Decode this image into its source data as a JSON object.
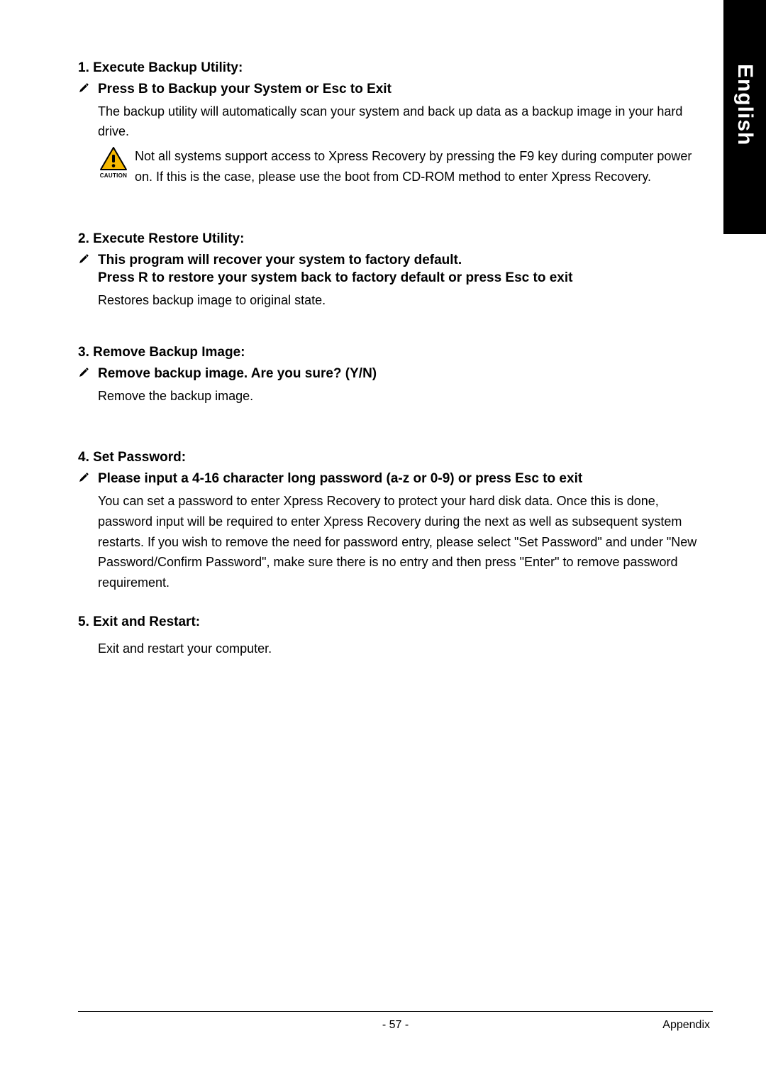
{
  "side_tab": "English",
  "sections": {
    "s1": {
      "head": "1. Execute Backup Utility:",
      "bullet": "Press B to Backup your System or Esc to Exit",
      "body": "The backup utility will automatically scan your system and back up data as a backup image in your hard drive.",
      "caution_label": "CAUTION",
      "caution_text": "Not all systems support access to Xpress Recovery by pressing the F9 key during computer power on. If this is the case, please use the boot from CD-ROM method to enter Xpress Recovery."
    },
    "s2": {
      "head": "2. Execute Restore Utility:",
      "bullet1": "This program will recover your system to factory default.",
      "bullet2": "Press R to restore your system back to factory default or press Esc to exit",
      "body": "Restores backup image to original state."
    },
    "s3": {
      "head": "3. Remove Backup Image:",
      "bullet": "Remove backup image.  Are you sure?  (Y/N)",
      "body": "Remove the backup image."
    },
    "s4": {
      "head": "4. Set Password:",
      "bullet": "Please input a 4-16 character long password (a-z or 0-9) or press Esc to exit",
      "body": "You can set a password to enter Xpress Recovery to protect your hard disk data.  Once this is done, password input will be required to enter Xpress Recovery during the next as well as subsequent system restarts.  If you wish to remove the need for password entry, please select \"Set Password\" and under \"New Password/Confirm Password\", make sure there is no entry and then press \"Enter\" to remove password requirement."
    },
    "s5": {
      "head": "5. Exit and Restart:",
      "body": "Exit and restart your computer."
    }
  },
  "footer": {
    "page": "- 57 -",
    "section": "Appendix"
  }
}
